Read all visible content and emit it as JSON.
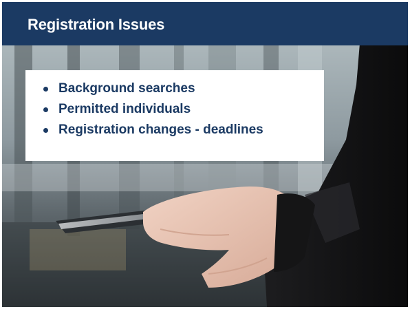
{
  "slide": {
    "title": "Registration Issues",
    "bullets": [
      "Background searches",
      "Permitted individuals",
      "Registration changes - deadlines"
    ],
    "photo_description_icon": "hands-holding-tablet-photo"
  },
  "colors": {
    "title_bar": "#1b3a63",
    "title_text": "#ffffff",
    "bullet_text": "#1b3a63",
    "bullet_box": "#ffffff"
  }
}
